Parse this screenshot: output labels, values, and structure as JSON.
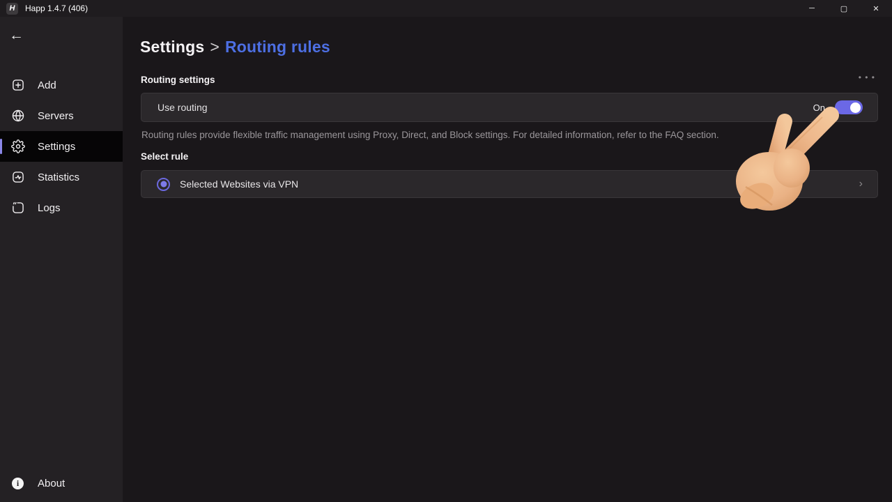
{
  "window": {
    "title": "Happ 1.4.7 (406)",
    "logo_letter": "H",
    "controls": {
      "minimize": "─",
      "maximize": "▢",
      "close": "✕"
    }
  },
  "sidebar": {
    "back_icon": "←",
    "items": [
      {
        "label": "Add",
        "icon": "add-square-icon",
        "active": false
      },
      {
        "label": "Servers",
        "icon": "globe-icon",
        "active": false
      },
      {
        "label": "Settings",
        "icon": "gear-icon",
        "active": true
      },
      {
        "label": "Statistics",
        "icon": "activity-icon",
        "active": false
      },
      {
        "label": "Logs",
        "icon": "logs-icon",
        "active": false
      }
    ],
    "about": {
      "label": "About",
      "icon_glyph": "i"
    }
  },
  "main": {
    "breadcrumb": {
      "parent": "Settings",
      "separator": ">",
      "current": "Routing rules"
    },
    "routing_settings": {
      "section_title": "Routing settings",
      "more_icon": "• • •",
      "use_routing": {
        "label": "Use routing",
        "state_label": "On",
        "enabled": true
      },
      "description": "Routing rules provide flexible traffic management using Proxy, Direct, and Block settings. For detailed information, refer to the FAQ section."
    },
    "select_rule": {
      "section_title": "Select rule",
      "selected_rule": {
        "label": "Selected Websites via VPN",
        "selected": true
      },
      "chevron_icon": "›"
    }
  },
  "colors": {
    "accent_blue": "#4d6fe3",
    "toggle_on_purple": "#6b68e6",
    "radio_purple": "#7d7ae8",
    "active_indicator_purple": "#8b87e8",
    "titlebar_bg": "#1f1c1f",
    "sidebar_bg": "#242124",
    "main_bg": "#1a171a",
    "card_bg": "#2b282b",
    "card_border": "#3a373a",
    "muted_text": "#9b979b"
  }
}
